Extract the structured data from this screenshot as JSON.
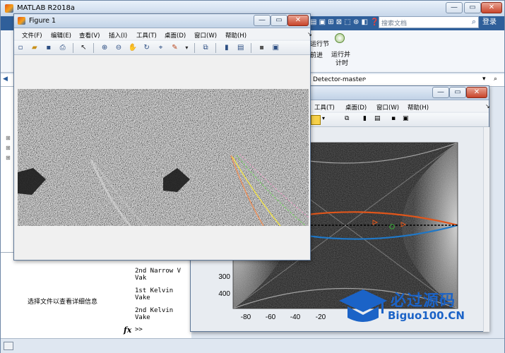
{
  "matlab": {
    "title": "MATLAB R2018a",
    "search_placeholder": "搜索文档",
    "login": "登录",
    "ribbon": {
      "run_section": "运行节",
      "advance": "前进",
      "run_and_time_1": "运行并",
      "run_and_time_2": "计时"
    },
    "path_fragment": "Detector-master",
    "details_text": "选择文件以查看详细信息",
    "command_lines": [
      "2nd Narrow V Vak",
      "1st Kelvin Vake",
      "2nd Kelvin Vake"
    ],
    "prompt": ">>",
    "fx": "fx"
  },
  "figure1": {
    "title": "Figure 1",
    "menu": [
      "文件(F)",
      "编辑(E)",
      "查看(V)",
      "插入(I)",
      "工具(T)",
      "桌面(D)",
      "窗口(W)",
      "帮助(H)"
    ]
  },
  "figure2": {
    "menu": [
      "工具(T)",
      "桌面(D)",
      "窗口(W)",
      "帮助(H)"
    ],
    "yticks": [
      "300",
      "400"
    ],
    "xticks": [
      "-80",
      "-60",
      "-40",
      "-20",
      "0",
      "20",
      "40",
      "60",
      "80"
    ]
  },
  "watermark": {
    "line1": "必过源码",
    "line2": "Biguo100.CN"
  }
}
